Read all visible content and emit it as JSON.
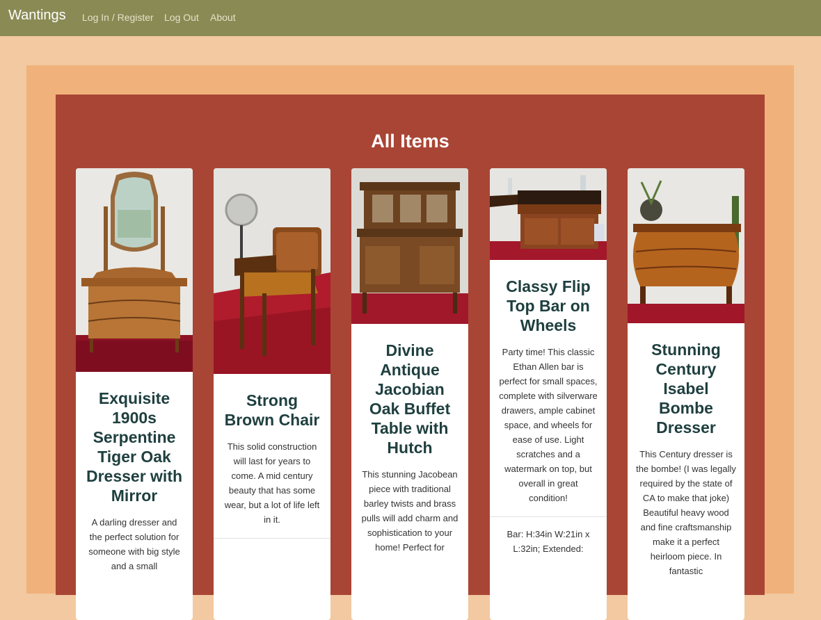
{
  "nav": {
    "brand": "Wantings",
    "links": [
      "Log In / Register",
      "Log Out",
      "About"
    ]
  },
  "page": {
    "heading": "All Items"
  },
  "items": [
    {
      "title": "Exquisite 1900s Serpentine Tiger Oak Dresser with Mirror",
      "description": "A darling dresser and the perfect solution for someone with big style and a small"
    },
    {
      "title": "Strong Brown Chair",
      "description": "This solid construction will last for years to come. A mid century beauty that has some wear, but a lot of life left in it."
    },
    {
      "title": "Divine Antique Jacobian Oak Buffet Table with Hutch",
      "description": "This stunning Jacobean piece with traditional barley twists and brass pulls will add charm and sophistication to your home! Perfect for"
    },
    {
      "title": "Classy Flip Top Bar on Wheels",
      "description": "Party time! This classic Ethan Allen bar is perfect for small spaces, complete with silverware drawers, ample cabinet space, and wheels for ease of use. Light scratches and a watermark on top, but overall in great condition!",
      "dimensions": "Bar: H:34in W:21in x L:32in; Extended:"
    },
    {
      "title": "Stunning Century Isabel Bombe Dresser",
      "description": "This Century dresser is the bombe! (I was legally required by the state of CA to make that joke) Beautiful heavy wood and fine craftsmanship make it a perfect heirloom piece. In fantastic"
    }
  ],
  "colors": {
    "navbar": "#8a8a55",
    "page_bg": "#f2c9a0",
    "frame": "#f0b27a",
    "panel": "#a94535",
    "title_text": "#1f3f3f"
  }
}
